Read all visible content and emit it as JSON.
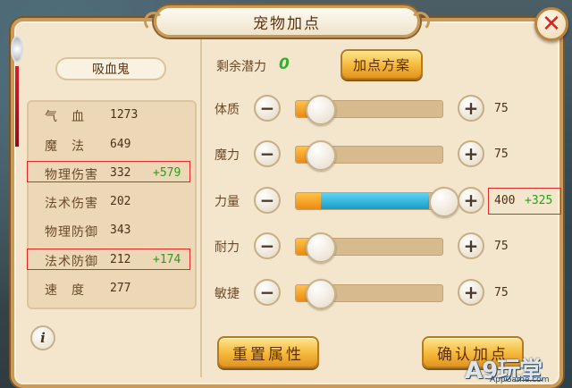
{
  "window": {
    "title": "宠物加点",
    "close_icon": "close-icon"
  },
  "pet": {
    "name": "吸血鬼"
  },
  "stats": [
    {
      "label": "气　血",
      "value": "1273",
      "bonus": ""
    },
    {
      "label": "魔　法",
      "value": "649",
      "bonus": ""
    },
    {
      "label": "物理伤害",
      "value": "332",
      "bonus": "+579"
    },
    {
      "label": "法术伤害",
      "value": "202",
      "bonus": ""
    },
    {
      "label": "物理防御",
      "value": "343",
      "bonus": ""
    },
    {
      "label": "法术防御",
      "value": "212",
      "bonus": "+174"
    },
    {
      "label": "速　度",
      "value": "277",
      "bonus": ""
    }
  ],
  "potential": {
    "label": "剩余潜力",
    "value": "0"
  },
  "buttons": {
    "plan": "加点方案",
    "reset": "重置属性",
    "confirm": "确认加点",
    "minus": "−",
    "plus": "+",
    "info": "i"
  },
  "attributes": [
    {
      "label": "体质",
      "value": "75",
      "bonus": "",
      "base_fraction": 0.17,
      "added_fraction": 0.0
    },
    {
      "label": "魔力",
      "value": "75",
      "bonus": "",
      "base_fraction": 0.17,
      "added_fraction": 0.0
    },
    {
      "label": "力量",
      "value": "400",
      "bonus": "+325",
      "base_fraction": 0.17,
      "added_fraction": 0.83
    },
    {
      "label": "耐力",
      "value": "75",
      "bonus": "",
      "base_fraction": 0.17,
      "added_fraction": 0.0
    },
    {
      "label": "敏捷",
      "value": "75",
      "bonus": "",
      "base_fraction": 0.17,
      "added_fraction": 0.0
    }
  ],
  "watermark": {
    "main": "A9玩堂",
    "sub": "AppGame.com"
  },
  "colors": {
    "bonus_green": "#2f9a1f",
    "potential_green": "#2fb02a",
    "highlight_red": "#e02a2a",
    "fill_orange": "#ec8a10",
    "fill_blue": "#179cc6"
  }
}
